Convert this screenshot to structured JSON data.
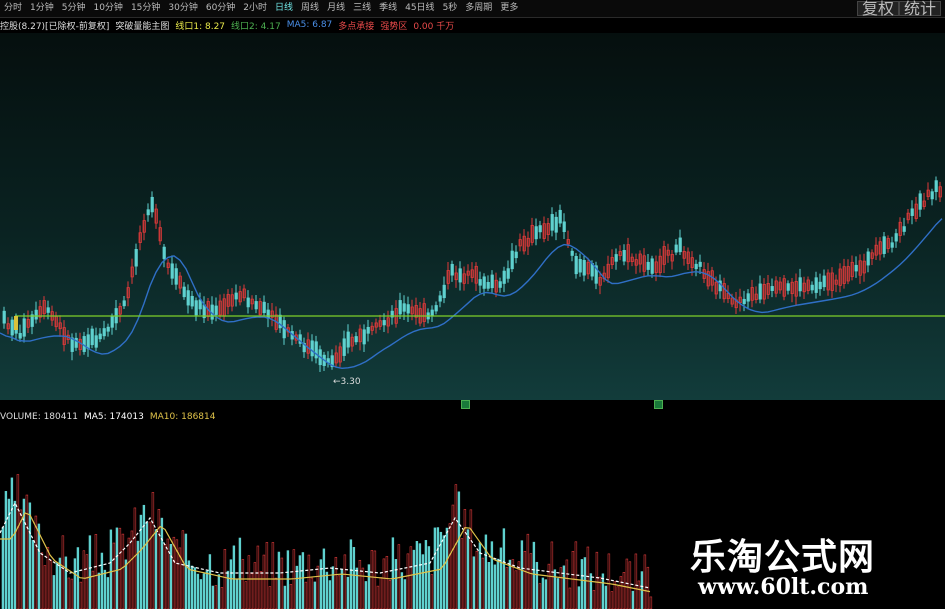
{
  "toolbar": {
    "periods": [
      "分时",
      "1分钟",
      "5分钟",
      "10分钟",
      "15分钟",
      "30分钟",
      "60分钟",
      "2小时",
      "日线",
      "周线",
      "月线",
      "三线",
      "季线",
      "45日线",
      "5秒",
      "多周期",
      "更多"
    ],
    "active_period": "日线",
    "right_buttons": [
      "复权",
      "统计"
    ]
  },
  "infobar": {
    "stock": "控股(8.27)[已除权-前复权]",
    "indicator": "突破量能主图",
    "line1": "线口1: 8.27",
    "line2": "线口2: 4.17",
    "ma": "MA5: 6.87",
    "signal1": "多点承接",
    "signal2": "强势区",
    "amount": "0.00 千万"
  },
  "main_chart": {
    "low_marker": "←3.30",
    "support_line_color": "#7ecf2a",
    "ma_line_color": "#2f6fc6",
    "up_color": "#e03a3a",
    "down_color": "#5fd1cf",
    "markers": [
      "signal-marker",
      "signal-marker"
    ]
  },
  "volume": {
    "label": "VOLUME: 180411",
    "ma5": "MA5: 174013",
    "ma10": "MA10: 186814",
    "ma5_color": "#ffffff",
    "ma10_color": "#e0c34a"
  },
  "watermark": {
    "title": "乐淘公式网",
    "url": "www.60lt.com"
  }
}
